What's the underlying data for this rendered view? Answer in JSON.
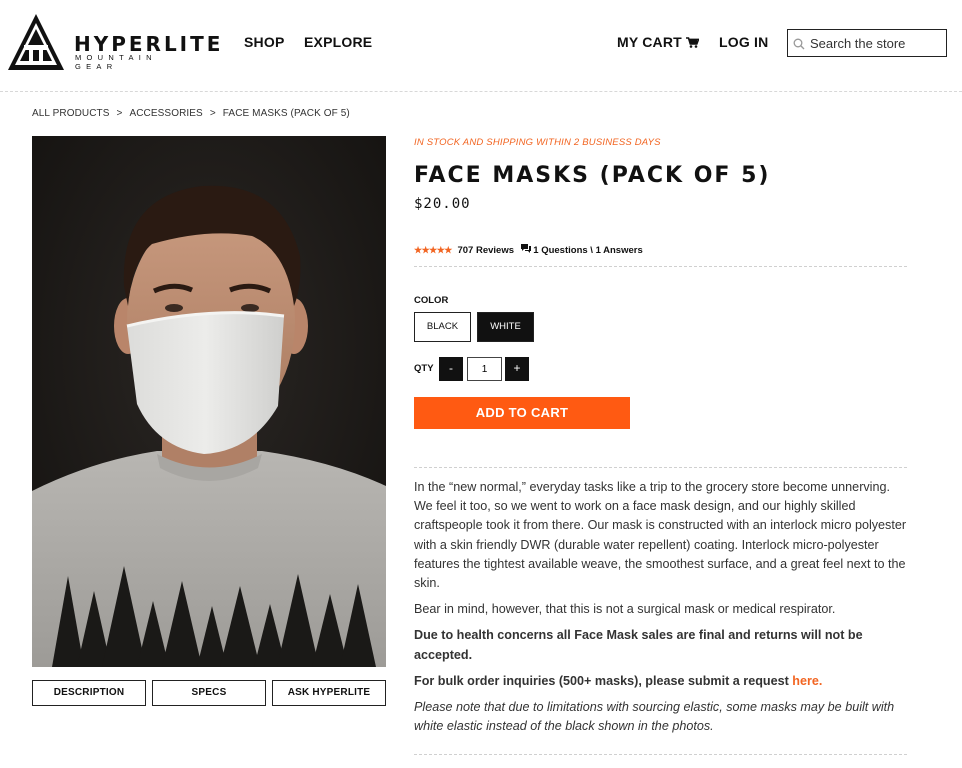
{
  "brand": {
    "name": "HYPERLITE",
    "sub": "MOUNTAIN GEAR"
  },
  "nav": {
    "shop": "SHOP",
    "explore": "EXPLORE",
    "cart": "MY CART",
    "login": "LOG IN"
  },
  "search": {
    "placeholder": "Search the store"
  },
  "breadcrumb": {
    "items": [
      "ALL PRODUCTS",
      "ACCESSORIES",
      "FACE MASKS (PACK OF 5)"
    ],
    "separator": ">"
  },
  "product": {
    "stock": "IN STOCK AND SHIPPING WITHIN 2 BUSINESS DAYS",
    "title": "FACE MASKS (PACK OF 5)",
    "price": "$20.00",
    "rating": {
      "stars": "★★★★★",
      "reviews": "707 Reviews",
      "qa": "1 Questions \\ 1 Answers"
    },
    "color_label": "COLOR",
    "colors": [
      "BLACK",
      "WHITE"
    ],
    "selected_color": "WHITE",
    "qty_label": "QTY",
    "qty": "1",
    "qty_minus": "-",
    "qty_plus": "+",
    "add_to_cart": "ADD TO CART"
  },
  "tabs": [
    "DESCRIPTION",
    "SPECS",
    "ASK HYPERLITE"
  ],
  "description": {
    "p1": "In the “new normal,” everyday tasks like a trip to the grocery store become unnerving. We feel it too, so we went to work on a face mask design, and our highly skilled craftspeople took it from there.  Our mask is constructed with an interlock micro polyester with a skin friendly DWR (durable water repellent) coating. Interlock micro-polyester features the tightest available weave, the smoothest surface, and a great feel next to the skin.",
    "p2": "Bear in mind, however, that this is not a surgical mask or medical respirator.",
    "p3": "Due to health concerns all Face Mask sales are final and returns will not be accepted.",
    "p4_text": "For bulk order inquiries (500+ masks), please submit a request ",
    "p4_link": "here.",
    "p5": "Please note that due to limitations with sourcing elastic, some masks may be built with white elastic instead of the black shown in the photos."
  },
  "colors": {
    "accent": "#f26522",
    "button": "#ff5a12",
    "dark": "#111111"
  }
}
